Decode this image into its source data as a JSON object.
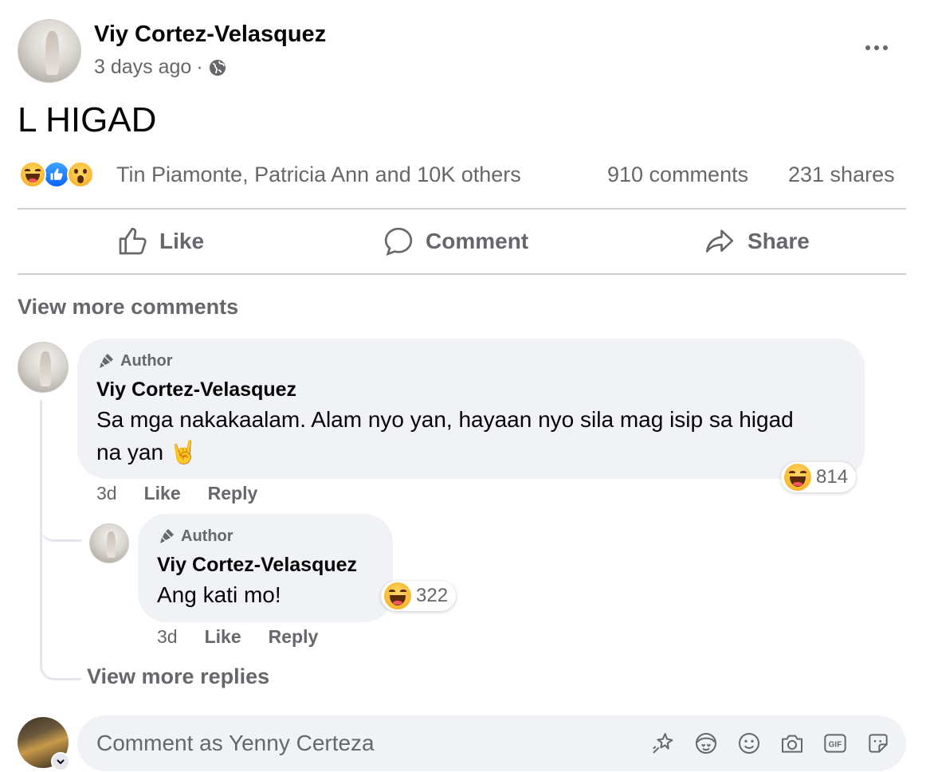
{
  "post": {
    "author_name": "Viy Cortez-Velasquez",
    "time": "3 days ago",
    "separator": "·",
    "body_text": "L HIGAD",
    "reactions_summary": "Tin Piamonte, Patricia Ann and 10K others",
    "comments_count": "910 comments",
    "shares_count": "231 shares"
  },
  "actions": {
    "like_label": "Like",
    "comment_label": "Comment",
    "share_label": "Share"
  },
  "comments_section": {
    "view_more_comments": "View more comments",
    "comments": [
      {
        "badge": "Author",
        "author": "Viy Cortez-Velasquez",
        "text_line1": "Sa mga nakakaalam. Alam nyo yan, hayaan nyo sila mag isip sa higad",
        "text_line2": "na yan",
        "emoji_suffix": "🤘",
        "time": "3d",
        "like_label": "Like",
        "reply_label": "Reply",
        "reaction_count": "814",
        "reaction_icon": "haha-emoji-icon"
      }
    ],
    "replies": [
      {
        "badge": "Author",
        "author": "Viy Cortez-Velasquez",
        "text": "Ang kati mo!",
        "time": "3d",
        "like_label": "Like",
        "reply_label": "Reply",
        "reaction_count": "322",
        "reaction_icon": "haha-emoji-icon"
      }
    ],
    "view_more_replies": "View more replies"
  },
  "composer": {
    "placeholder": "Comment as Yenny Certeza",
    "tools": [
      "sparkle-sticker-icon",
      "avatar-sticker-icon",
      "emoji-icon",
      "camera-icon",
      "gif-icon",
      "sticker-icon"
    ]
  },
  "colors": {
    "text_primary": "#050505",
    "text_secondary": "#65676b",
    "bubble_bg": "#f0f2f5",
    "divider": "#ced0d4",
    "like_blue": "#0866ff"
  }
}
